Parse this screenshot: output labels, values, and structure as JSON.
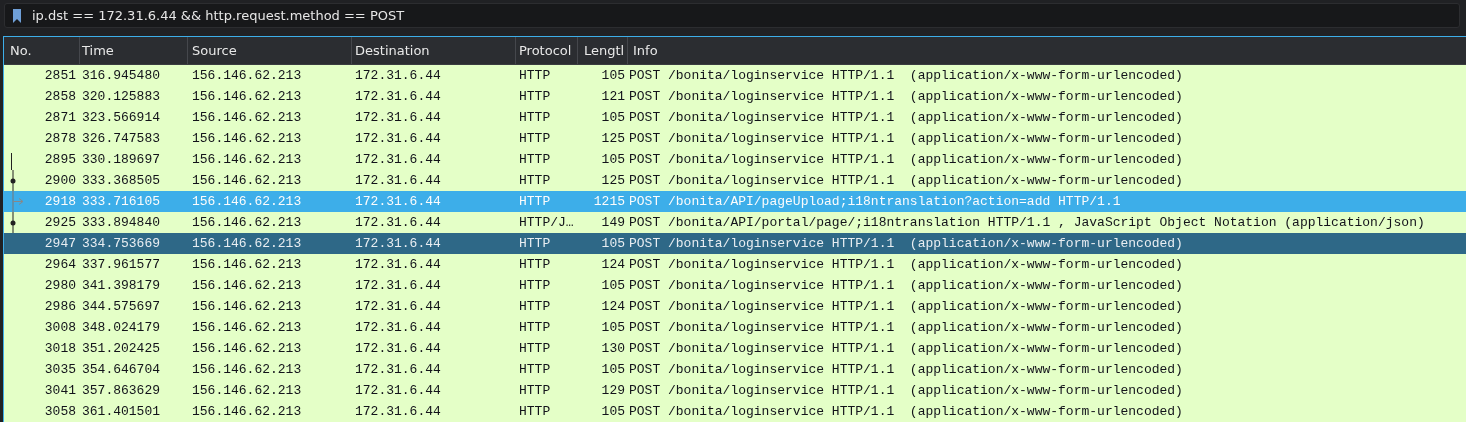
{
  "filter": {
    "value": "ip.dst == 172.31.6.44 && http.request.method == POST"
  },
  "table": {
    "columns": [
      "No.",
      "Time",
      "Source",
      "Destination",
      "Protocol",
      "Lengtl",
      "Info"
    ],
    "rows": [
      {
        "no": "2851",
        "time": "316.945480",
        "source": "156.146.62.213",
        "destination": "172.31.6.44",
        "protocol": "HTTP",
        "length": "105",
        "info": "POST /bonita/loginservice HTTP/1.1  (application/x-www-form-urlencoded)",
        "selected": false,
        "marked": false,
        "related": false
      },
      {
        "no": "2858",
        "time": "320.125883",
        "source": "156.146.62.213",
        "destination": "172.31.6.44",
        "protocol": "HTTP",
        "length": "121",
        "info": "POST /bonita/loginservice HTTP/1.1  (application/x-www-form-urlencoded)",
        "selected": false,
        "marked": false,
        "related": false
      },
      {
        "no": "2871",
        "time": "323.566914",
        "source": "156.146.62.213",
        "destination": "172.31.6.44",
        "protocol": "HTTP",
        "length": "105",
        "info": "POST /bonita/loginservice HTTP/1.1  (application/x-www-form-urlencoded)",
        "selected": false,
        "marked": false,
        "related": false
      },
      {
        "no": "2878",
        "time": "326.747583",
        "source": "156.146.62.213",
        "destination": "172.31.6.44",
        "protocol": "HTTP",
        "length": "125",
        "info": "POST /bonita/loginservice HTTP/1.1  (application/x-www-form-urlencoded)",
        "selected": false,
        "marked": false,
        "related": false
      },
      {
        "no": "2895",
        "time": "330.189697",
        "source": "156.146.62.213",
        "destination": "172.31.6.44",
        "protocol": "HTTP",
        "length": "105",
        "info": "POST /bonita/loginservice HTTP/1.1  (application/x-www-form-urlencoded)",
        "selected": false,
        "marked": false,
        "related": true,
        "kind": "line"
      },
      {
        "no": "2900",
        "time": "333.368505",
        "source": "156.146.62.213",
        "destination": "172.31.6.44",
        "protocol": "HTTP",
        "length": "125",
        "info": "POST /bonita/loginservice HTTP/1.1  (application/x-www-form-urlencoded)",
        "selected": false,
        "marked": false,
        "related": true,
        "kind": "dot"
      },
      {
        "no": "2918",
        "time": "333.716105",
        "source": "156.146.62.213",
        "destination": "172.31.6.44",
        "protocol": "HTTP",
        "length": "1215",
        "info": "POST /bonita/API/pageUpload;i18ntranslation?action=add HTTP/1.1",
        "selected": false,
        "marked": true,
        "related": true,
        "kind": "arrow"
      },
      {
        "no": "2925",
        "time": "333.894840",
        "source": "156.146.62.213",
        "destination": "172.31.6.44",
        "protocol": "HTTP/J…",
        "length": "149",
        "info": "POST /bonita/API/portal/page/;i18ntranslation HTTP/1.1 , JavaScript Object Notation (application/json)",
        "selected": false,
        "marked": false,
        "related": true,
        "kind": "dot"
      },
      {
        "no": "2947",
        "time": "334.753669",
        "source": "156.146.62.213",
        "destination": "172.31.6.44",
        "protocol": "HTTP",
        "length": "105",
        "info": "POST /bonita/loginservice HTTP/1.1  (application/x-www-form-urlencoded)",
        "selected": true,
        "marked": false,
        "related": false
      },
      {
        "no": "2964",
        "time": "337.961577",
        "source": "156.146.62.213",
        "destination": "172.31.6.44",
        "protocol": "HTTP",
        "length": "124",
        "info": "POST /bonita/loginservice HTTP/1.1  (application/x-www-form-urlencoded)",
        "selected": false,
        "marked": false,
        "related": false
      },
      {
        "no": "2980",
        "time": "341.398179",
        "source": "156.146.62.213",
        "destination": "172.31.6.44",
        "protocol": "HTTP",
        "length": "105",
        "info": "POST /bonita/loginservice HTTP/1.1  (application/x-www-form-urlencoded)",
        "selected": false,
        "marked": false,
        "related": false
      },
      {
        "no": "2986",
        "time": "344.575697",
        "source": "156.146.62.213",
        "destination": "172.31.6.44",
        "protocol": "HTTP",
        "length": "124",
        "info": "POST /bonita/loginservice HTTP/1.1  (application/x-www-form-urlencoded)",
        "selected": false,
        "marked": false,
        "related": false
      },
      {
        "no": "3008",
        "time": "348.024179",
        "source": "156.146.62.213",
        "destination": "172.31.6.44",
        "protocol": "HTTP",
        "length": "105",
        "info": "POST /bonita/loginservice HTTP/1.1  (application/x-www-form-urlencoded)",
        "selected": false,
        "marked": false,
        "related": false
      },
      {
        "no": "3018",
        "time": "351.202425",
        "source": "156.146.62.213",
        "destination": "172.31.6.44",
        "protocol": "HTTP",
        "length": "130",
        "info": "POST /bonita/loginservice HTTP/1.1  (application/x-www-form-urlencoded)",
        "selected": false,
        "marked": false,
        "related": false
      },
      {
        "no": "3035",
        "time": "354.646704",
        "source": "156.146.62.213",
        "destination": "172.31.6.44",
        "protocol": "HTTP",
        "length": "105",
        "info": "POST /bonita/loginservice HTTP/1.1  (application/x-www-form-urlencoded)",
        "selected": false,
        "marked": false,
        "related": false
      },
      {
        "no": "3041",
        "time": "357.863629",
        "source": "156.146.62.213",
        "destination": "172.31.6.44",
        "protocol": "HTTP",
        "length": "129",
        "info": "POST /bonita/loginservice HTTP/1.1  (application/x-www-form-urlencoded)",
        "selected": false,
        "marked": false,
        "related": false
      },
      {
        "no": "3058",
        "time": "361.401501",
        "source": "156.146.62.213",
        "destination": "172.31.6.44",
        "protocol": "HTTP",
        "length": "105",
        "info": "POST /bonita/loginservice HTTP/1.1  (application/x-www-form-urlencoded)",
        "selected": false,
        "marked": false,
        "related": false
      }
    ]
  }
}
